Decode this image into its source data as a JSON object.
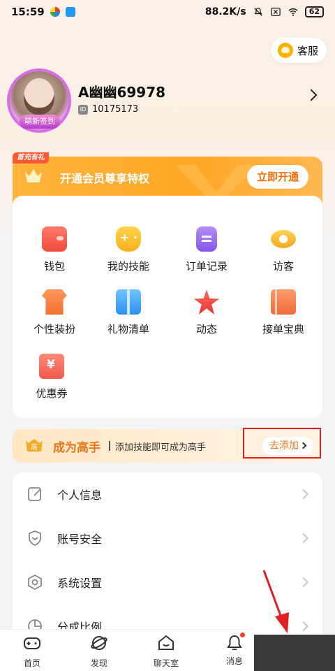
{
  "status_bar": {
    "time": "15:59",
    "network_speed": "88.2K/s",
    "battery": "62"
  },
  "service": {
    "label": "客服"
  },
  "profile": {
    "username": "A幽幽69978",
    "id_tag": "ID",
    "id": "10175173",
    "avatar_badge": "萌新签到"
  },
  "vip": {
    "tag": "首充有礼",
    "text": "开通会员尊享特权",
    "button": "立即开通"
  },
  "grid": {
    "items": [
      {
        "label": "钱包",
        "icon": "wallet-icon"
      },
      {
        "label": "我的技能",
        "icon": "gamepad-icon"
      },
      {
        "label": "订单记录",
        "icon": "order-icon"
      },
      {
        "label": "访客",
        "icon": "eye-icon"
      },
      {
        "label": "个性装扮",
        "icon": "shirt-icon"
      },
      {
        "label": "礼物清单",
        "icon": "gift-icon"
      },
      {
        "label": "动态",
        "icon": "star-icon"
      },
      {
        "label": "接单宝典",
        "icon": "book-icon"
      },
      {
        "label": "优惠券",
        "icon": "coupon-icon"
      }
    ]
  },
  "expert": {
    "badge": "高",
    "title": "成为高手",
    "desc": "添加技能即可成为高手",
    "button": "去添加"
  },
  "settings": {
    "items": [
      {
        "label": "个人信息",
        "icon": "edit-icon"
      },
      {
        "label": "账号安全",
        "icon": "shield-icon"
      },
      {
        "label": "系统设置",
        "icon": "settings-icon"
      },
      {
        "label": "分成比例",
        "icon": "pie-chart-icon"
      }
    ]
  },
  "nav": {
    "items": [
      {
        "label": "首页",
        "icon": "gamepad-icon"
      },
      {
        "label": "发现",
        "icon": "planet-icon"
      },
      {
        "label": "聊天室",
        "icon": "home-smile-icon"
      },
      {
        "label": "消息",
        "icon": "bell-icon"
      }
    ]
  },
  "colors": {
    "accent_orange": "#ffa726",
    "cta_text": "#ff6a00",
    "expert_text": "#e8781a",
    "highlight_red": "#e02020"
  }
}
